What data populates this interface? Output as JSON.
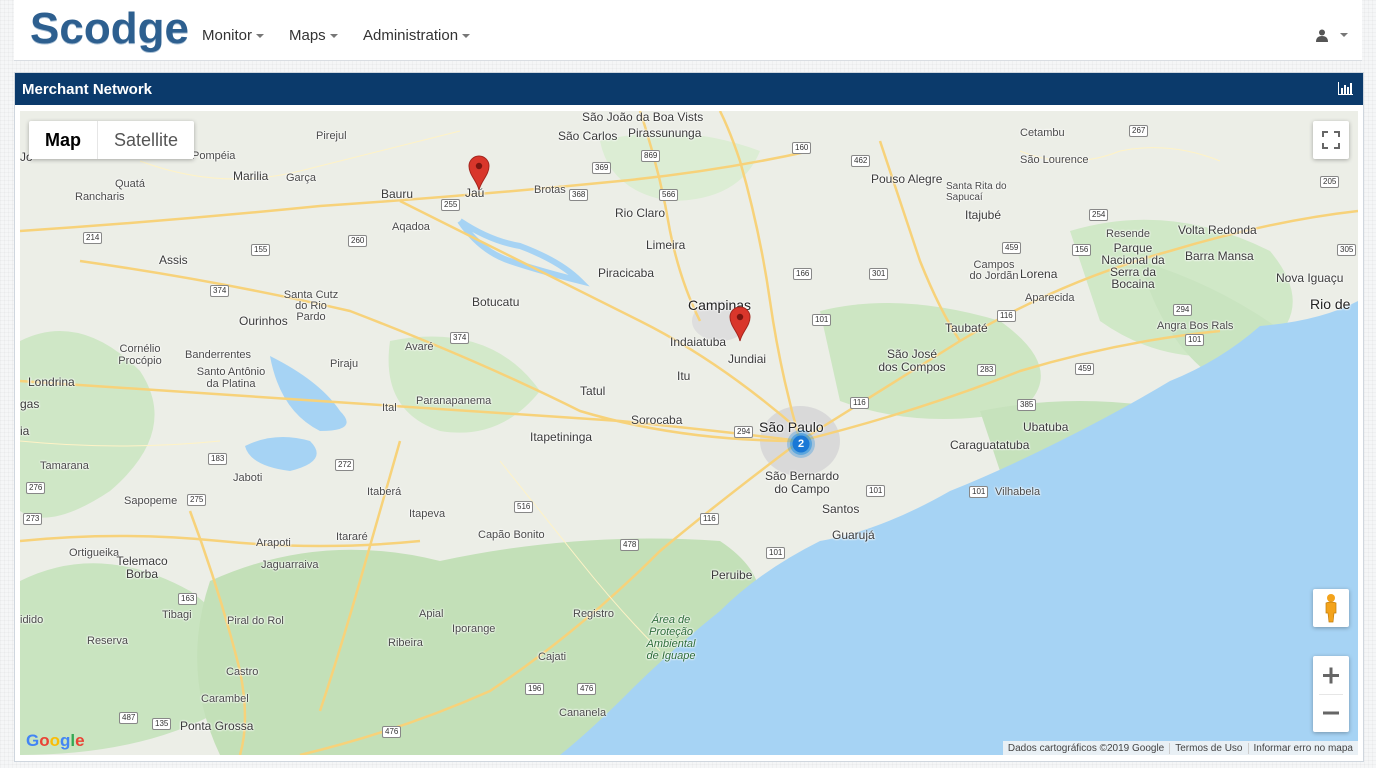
{
  "app": {
    "brand": "Scodge",
    "nav": [
      {
        "label": "Monitor"
      },
      {
        "label": "Maps"
      },
      {
        "label": "Administration"
      }
    ]
  },
  "panel": {
    "title": "Merchant Network"
  },
  "map": {
    "type_buttons": {
      "map": "Map",
      "satellite": "Satellite"
    },
    "cluster_count": "2",
    "attribution": {
      "data": "Dados cartográficos ©2019 Google",
      "terms": "Termos de Uso",
      "report": "Informar erro no mapa"
    },
    "google": "Google",
    "colors": {
      "header": "#0b3a6b",
      "brand": "#2d5f8f",
      "marker": "#d9362b",
      "cluster": "#1a8ce0",
      "water": "#a6d3f4",
      "land": "#eceee7",
      "forest": "#c9e4c0"
    },
    "labels": {
      "sao_joao": "São João da Boa Vists",
      "sao_carlos": "São Carlos",
      "pirassununga": "Pirassununga",
      "cetambu": "Cetambu",
      "pirejul": "Pirejul",
      "pompeia": "Pompéia",
      "marilia": "Marilia",
      "garca": "Garça",
      "bauru": "Bauru",
      "jau": "Jaú",
      "brotas": "Brotas",
      "rio_claro": "Rio Claro",
      "pouso_alegre": "Pouso Alegre",
      "sao_lourence": "São Lourence",
      "santa_rita": "Santa Rita do Sapucaí",
      "itajube": "Itajubé",
      "volta_redonda": "Volta Redonda",
      "resende": "Resende",
      "parque": "Parque Nacional da Serra da Bocaina",
      "barra_mansa": "Barra Mansa",
      "nova_iguacu": "Nova Iguaçu",
      "rio": "Rio de",
      "quata": "Quatá",
      "rancharis": "Rancharis",
      "aqadoa": "Aqadoa",
      "limeira": "Limeira",
      "assis": "Assis",
      "piracicaba": "Piracicaba",
      "campos": "Campos do Jordãn",
      "lorena": "Lorena",
      "aparecida": "Aparecida",
      "santa_cutz": "Santa Cutz do Rio Pardo",
      "botucatu": "Botucatu",
      "campinas": "Campinas",
      "ourinhos": "Ourinhos",
      "taubate": "Taubaté",
      "angra": "Angra Bos Rals",
      "cornelio": "Cornélio Procópio",
      "bandeirantes": "Banderrentes",
      "santo_antonio": "Santo Antônio da Platina",
      "pirajui": "Piraju",
      "avare": "Avaré",
      "indaiatuba": "Indaiatuba",
      "jundiai": "Jundiai",
      "sao_jose": "São José dos Compos",
      "londrina": "Londrina",
      "itu": "Itu",
      "tatul": "Tatul",
      "gas": "gas",
      "ital": "Ital",
      "paranapanema": "Paranapanema",
      "sorocaba": "Sorocaba",
      "ubatuba": "Ubatuba",
      "ia": "ia",
      "itapetininga": "Itapetininga",
      "sao_paulo": "São Paulo",
      "caraguatatuba": "Caraguatatuba",
      "tamarana": "Tamarana",
      "jaboti": "Jaboti",
      "sao_bernardo": "São Bernardo do Campo",
      "vilhabela": "Vilhabela",
      "sapopeme": "Sapopeme",
      "itabera": "Itaberá",
      "itapeva": "Itapeva",
      "santos": "Santos",
      "guaruja": "Guarujá",
      "capao_bonito": "Capão Bonito",
      "ortigueika": "Ortigueika",
      "arapoti": "Arapoti",
      "itarare": "Itararé",
      "telemaco": "Telemaco Borba",
      "jaguariaiva": "Jaguarraiva",
      "peruibe": "Peruibe",
      "tibagi": "Tibagi",
      "registro": "Registro",
      "area": "Área de Proteção Ambiental de Iguape",
      "idido": "idido",
      "reserva": "Reserva",
      "pirai": "Piral do Rol",
      "apial": "Apial",
      "iporange": "Iporange",
      "ribeira": "Ribeira",
      "cajati": "Cajati",
      "castro": "Castro",
      "carambel": "Carambel",
      "cananeia": "Cananela",
      "ponta_grossa": "Ponta Grossa",
      "jo": "Jo"
    },
    "shields": {
      "s369": "369",
      "s869": "869",
      "s160": "160",
      "s462": "462",
      "s267": "267",
      "s368": "368",
      "s566": "566",
      "s255": "255",
      "s205": "205",
      "s214": "214",
      "s155": "155",
      "s260": "260",
      "s254": "254",
      "s459": "459",
      "s156": "156",
      "s305": "305",
      "s166": "166",
      "s301": "301",
      "s374": "374",
      "s374b": "374",
      "s101": "101",
      "s116": "116",
      "s294": "294",
      "s385": "385",
      "s283": "283",
      "s459b": "459",
      "s116b": "116",
      "s183": "183",
      "s272": "272",
      "s276": "276",
      "s275": "275",
      "s273": "273",
      "s101b": "101",
      "s101c": "101",
      "s516": "516",
      "s116c": "116",
      "s478": "478",
      "s101d": "101",
      "s163": "163",
      "s196": "196",
      "s476": "476",
      "s476b": "476",
      "s487": "487",
      "s135": "135",
      "s101e": "101"
    }
  }
}
